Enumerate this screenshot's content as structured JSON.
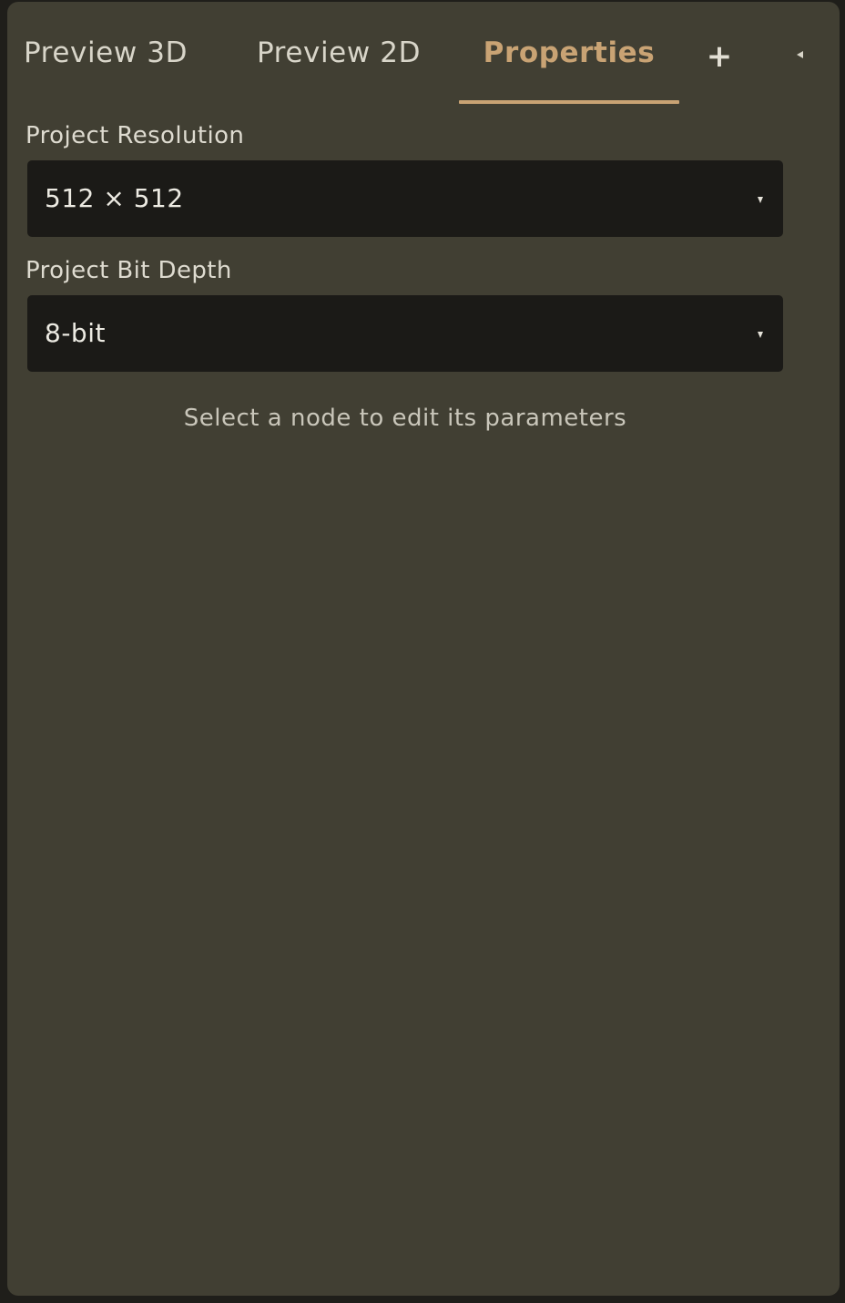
{
  "tabs": [
    {
      "label": "Preview 3D",
      "active": false
    },
    {
      "label": "Preview 2D",
      "active": false
    },
    {
      "label": "Properties",
      "active": true
    }
  ],
  "add_tab_label": "+",
  "colors": {
    "accent": "#c9a374",
    "panel_background": "#413f33",
    "select_background": "#1b1a17",
    "outer_background": "#1f1e1a"
  },
  "icons": {
    "add_tab": "plus-icon",
    "collapse": "triangle-left-icon",
    "select_arrow": "triangle-down-icon"
  },
  "properties": {
    "resolution": {
      "label": "Project Resolution",
      "value": "512 × 512"
    },
    "bit_depth": {
      "label": "Project Bit Depth",
      "value": "8-bit"
    },
    "empty_hint": "Select a node to edit its parameters"
  }
}
